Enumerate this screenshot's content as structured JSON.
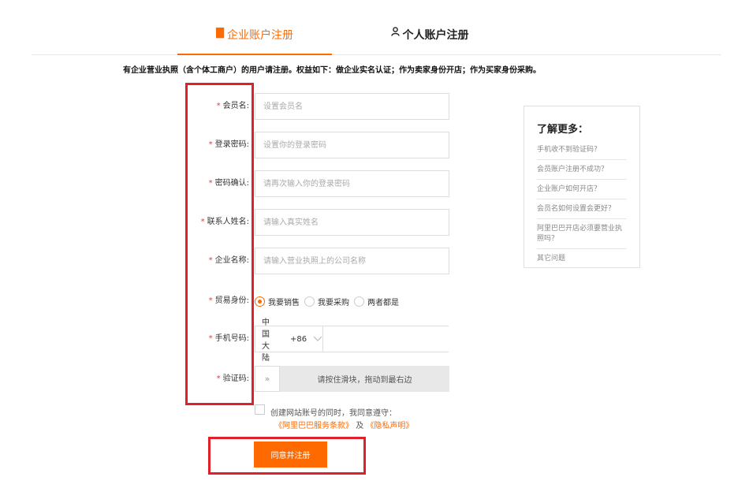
{
  "tabs": {
    "enterprise": "企业账户注册",
    "personal": "个人账户注册"
  },
  "notice": "有企业营业执照（含个体工商户）的用户请注册。权益如下：做企业实名认证；作为卖家身份开店；作为买家身份采购。",
  "form": {
    "required_mark": "*",
    "member_name": {
      "label": "会员名:",
      "placeholder": "设置会员名"
    },
    "password": {
      "label": "登录密码:",
      "placeholder": "设置你的登录密码"
    },
    "password_confirm": {
      "label": "密码确认:",
      "placeholder": "请再次输入你的登录密码"
    },
    "contact_name": {
      "label": "联系人姓名:",
      "placeholder": "请输入真实姓名"
    },
    "company_name": {
      "label": "企业名称:",
      "placeholder": "请输入营业执照上的公司名称"
    },
    "trade_role": {
      "label": "贸易身份:",
      "options": [
        "我要销售",
        "我要采购",
        "两者都是"
      ],
      "selected": "我要销售"
    },
    "phone": {
      "label": "手机号码:",
      "region": "中国大陆",
      "code": "+86"
    },
    "captcha": {
      "label": "验证码:",
      "slider_text": "请按住滑块，拖动到最右边",
      "handle": "»"
    }
  },
  "agreement": {
    "text": "创建网站账号的同时，我同意遵守：",
    "terms": "《阿里巴巴服务条款》",
    "and": "及",
    "privacy": "《隐私声明》"
  },
  "submit_label": "同意并注册",
  "help": {
    "title": "了解更多：",
    "items": [
      "手机收不到验证码？",
      "会员账户注册不成功？",
      "企业账户如何开店？",
      "会员名如何设置会更好？",
      "阿里巴巴开店必须要营业执照吗？",
      "其它问题"
    ]
  },
  "colors": {
    "accent": "#ff6a00",
    "highlight": "#e0202a"
  }
}
